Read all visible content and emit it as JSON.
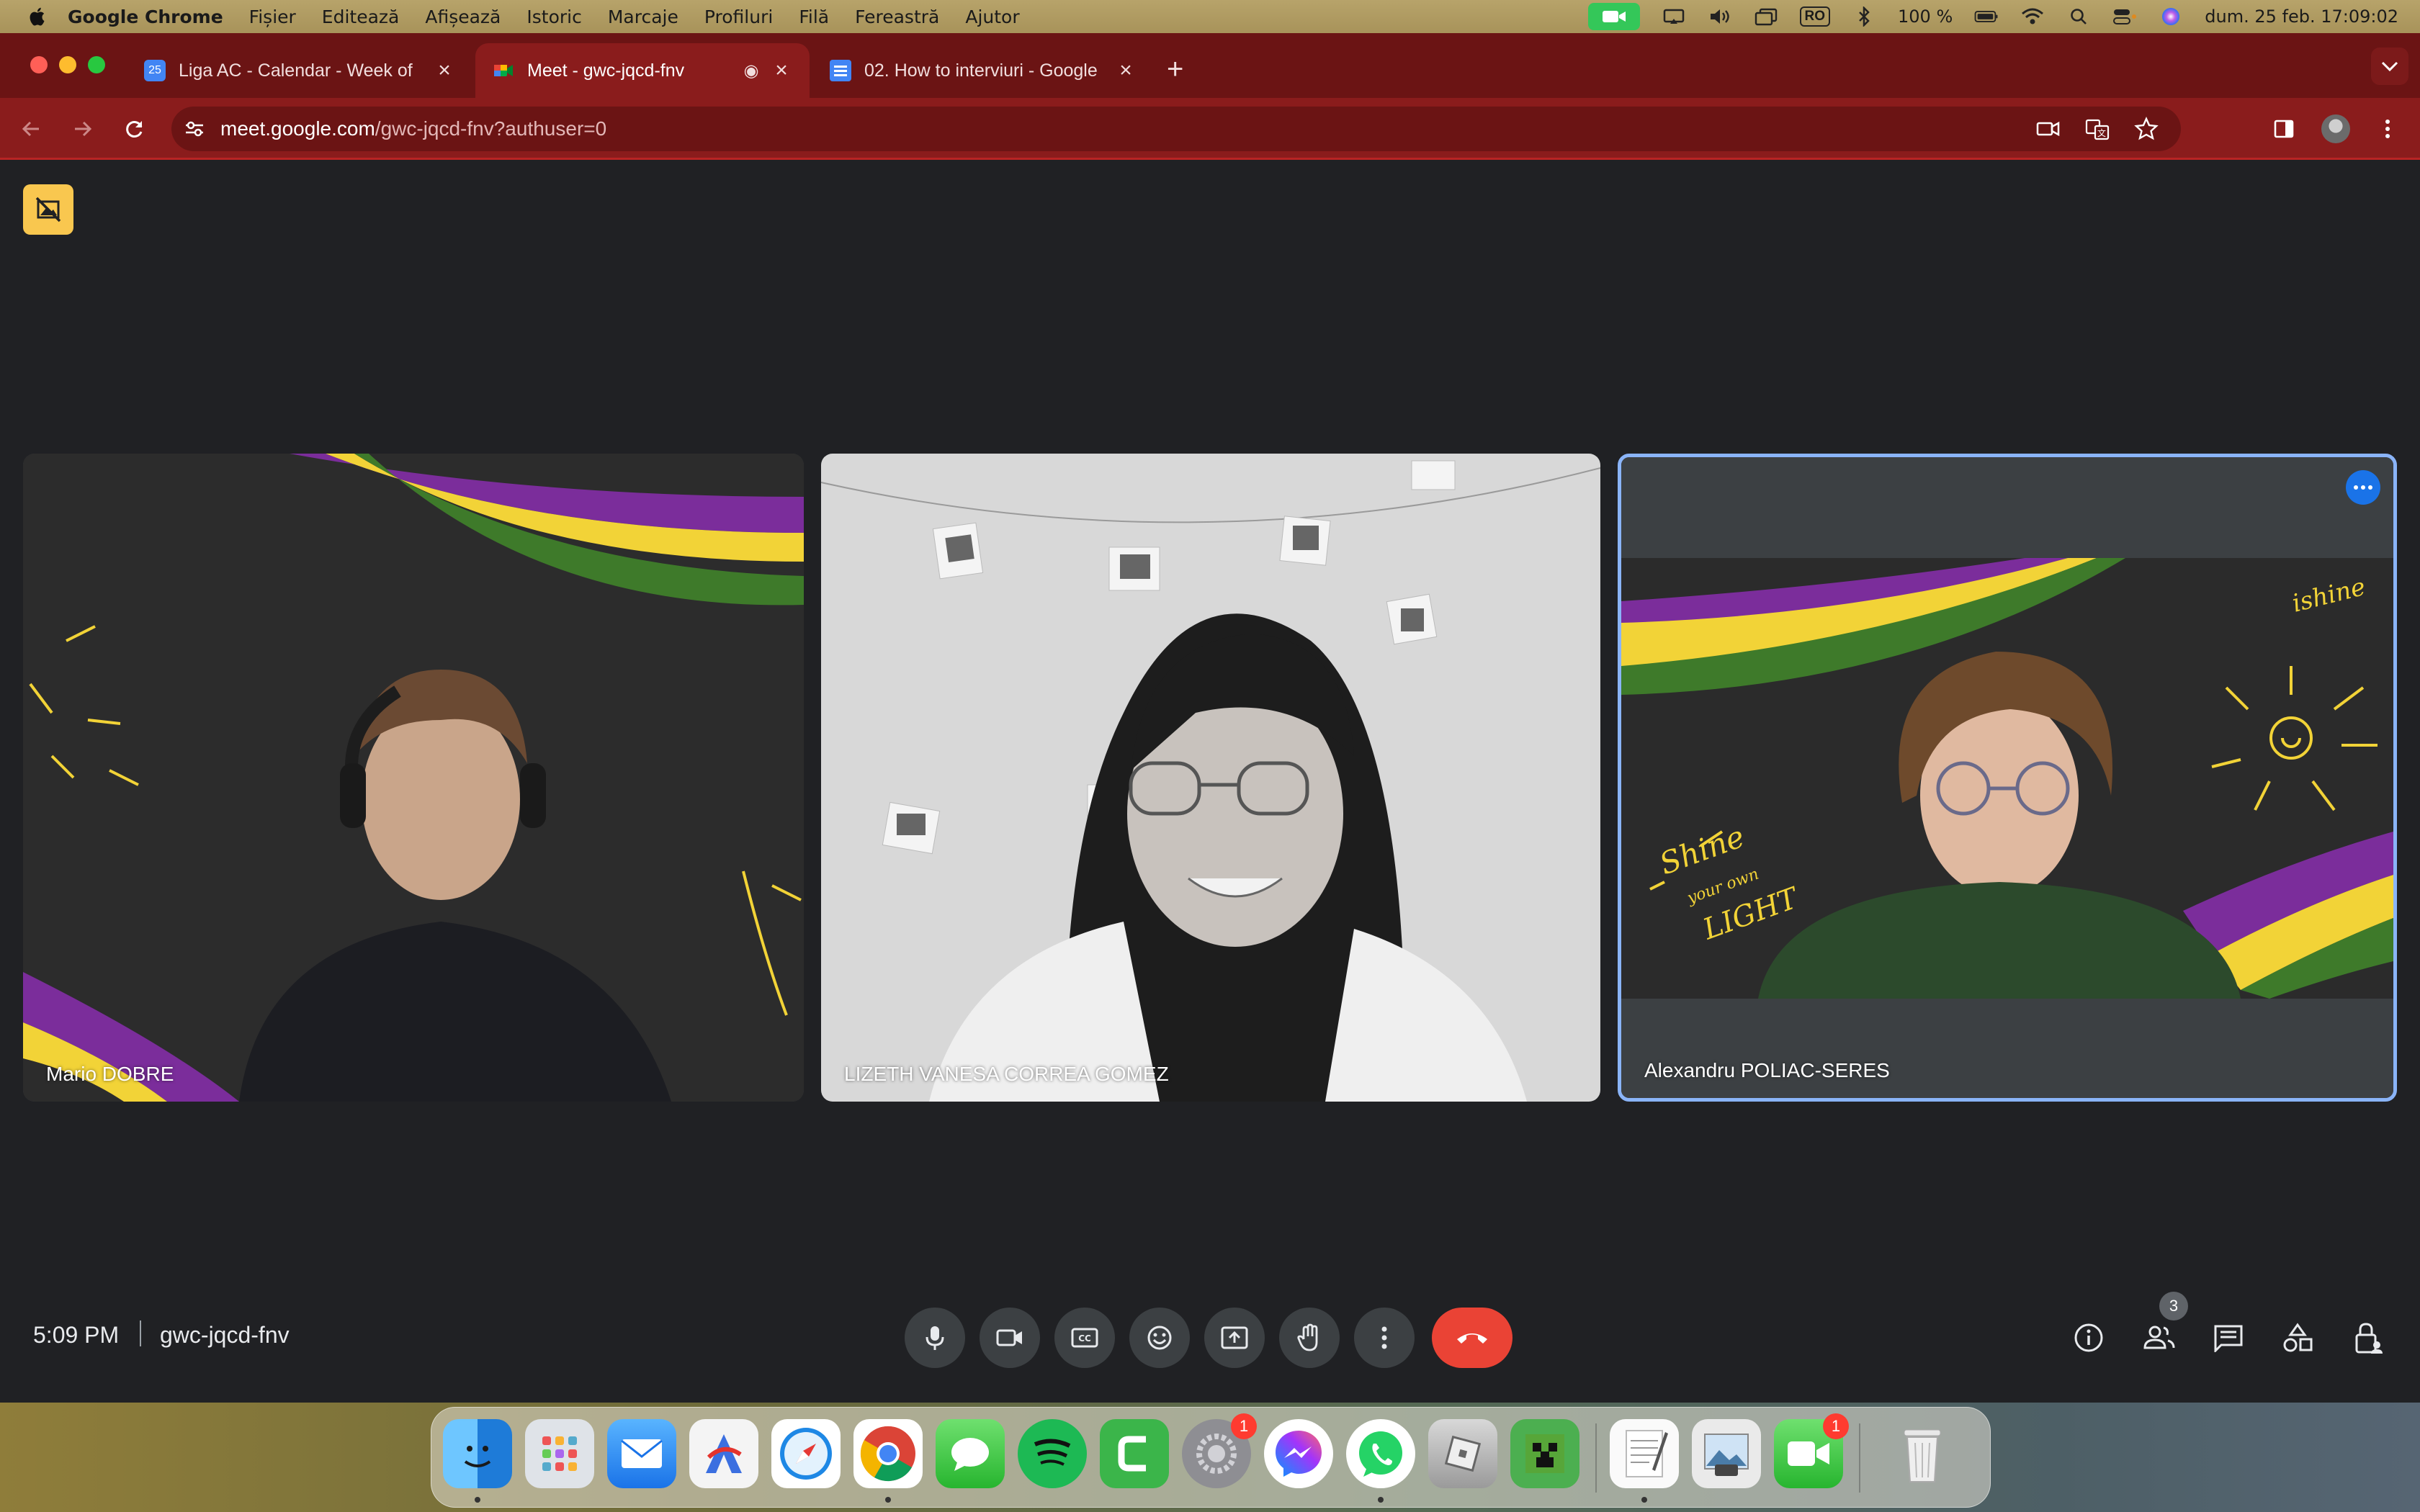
{
  "menubar": {
    "app_name": "Google Chrome",
    "menus": [
      "Fișier",
      "Editează",
      "Afișează",
      "Istoric",
      "Marcaje",
      "Profiluri",
      "Filă",
      "Fereastră",
      "Ajutor"
    ],
    "input_source": "RO",
    "battery": "100 %",
    "clock": "dum. 25 feb.  17:09:02"
  },
  "tabs": [
    {
      "title": "Liga AC - Calendar - Week of",
      "favicon": "calendar-icon",
      "active": false
    },
    {
      "title": "Meet - gwc-jqcd-fnv",
      "favicon": "meet-icon",
      "active": true
    },
    {
      "title": "02. How to interviuri - Google",
      "favicon": "docs-icon",
      "active": false
    }
  ],
  "omnibox": {
    "host": "meet.google.com",
    "path": "/gwc-jqcd-fnv?authuser=0"
  },
  "meet": {
    "participants": [
      {
        "name": "Mario DOBRE",
        "speaking": false
      },
      {
        "name": "LIZETH VANESA CORREA GOMEZ",
        "speaking": false
      },
      {
        "name": "Alexandru POLIAC-SERES",
        "speaking": true
      }
    ],
    "time": "5:09 PM",
    "meeting_code": "gwc-jqcd-fnv",
    "people_count": "3",
    "controls": [
      "microphone",
      "camera",
      "captions",
      "reactions",
      "present",
      "raise-hand",
      "more-options",
      "leave-call"
    ],
    "side_controls": [
      "meeting-details",
      "people",
      "chat",
      "activities",
      "host-controls"
    ]
  },
  "dock": {
    "apps": [
      {
        "name": "Finder",
        "icon": "finder-icon",
        "running": true
      },
      {
        "name": "Launchpad",
        "icon": "launchpad-icon",
        "running": false
      },
      {
        "name": "Mail",
        "icon": "mail-icon",
        "running": false
      },
      {
        "name": "Artstudio",
        "icon": "artstudio-icon",
        "running": false
      },
      {
        "name": "Safari",
        "icon": "safari-icon",
        "running": false
      },
      {
        "name": "Google Chrome",
        "icon": "chrome-icon",
        "running": true
      },
      {
        "name": "Messages",
        "icon": "messages-icon",
        "running": false
      },
      {
        "name": "Spotify",
        "icon": "spotify-icon",
        "running": false
      },
      {
        "name": "Camtasia",
        "icon": "camtasia-icon",
        "running": false
      },
      {
        "name": "System Settings",
        "icon": "settings-icon",
        "running": false,
        "badge": "1"
      },
      {
        "name": "Messenger",
        "icon": "messenger-icon",
        "running": false
      },
      {
        "name": "WhatsApp",
        "icon": "whatsapp-icon",
        "running": true
      },
      {
        "name": "Roblox",
        "icon": "roblox-icon",
        "running": false
      },
      {
        "name": "Minecraft",
        "icon": "minecraft-icon",
        "running": false
      },
      {
        "name": "TextEdit",
        "icon": "textedit-icon",
        "running": true
      },
      {
        "name": "Preview",
        "icon": "preview-icon",
        "running": false
      },
      {
        "name": "FaceTime",
        "icon": "facetime-icon",
        "running": false,
        "badge": "1"
      },
      {
        "name": "Trash",
        "icon": "trash-icon",
        "running": false
      }
    ]
  },
  "colors": {
    "tab_strip": "#6b1414",
    "toolbar": "#8a1c1c",
    "meet_bg": "#202124",
    "end_call": "#ea4335",
    "active_speaker": "#8ab4f8"
  }
}
